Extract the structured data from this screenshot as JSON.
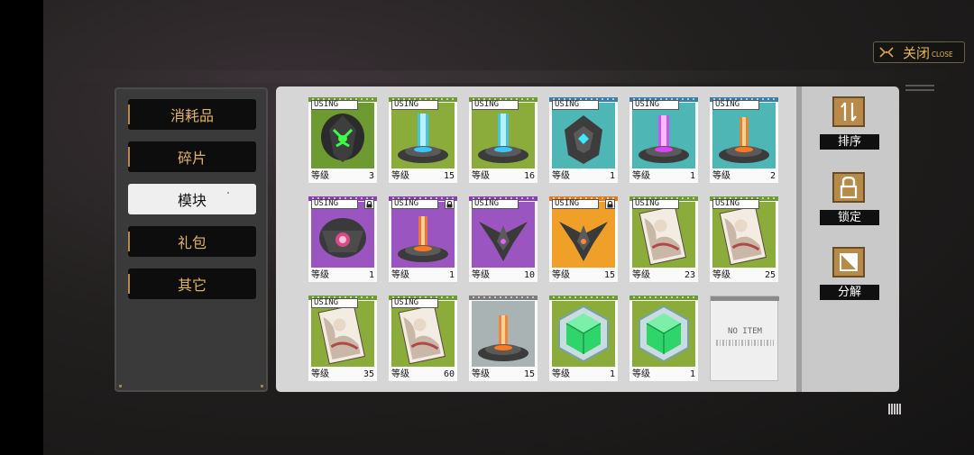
{
  "close": {
    "label": "关闭",
    "sub_label": "CLOSE",
    "icon": "close-x-icon"
  },
  "categories": [
    {
      "label": "消耗品",
      "active": false
    },
    {
      "label": "碎片",
      "active": false
    },
    {
      "label": "模块",
      "active": true
    },
    {
      "label": "礼包",
      "active": false
    },
    {
      "label": "其它",
      "active": false
    }
  ],
  "items": [
    {
      "status": "USING",
      "level_label": "等级",
      "level": "3",
      "frame": "#6e9a32",
      "bg": "#6e9a32",
      "art": "green-core-module",
      "locked": false
    },
    {
      "status": "USING",
      "level_label": "等级",
      "level": "15",
      "frame": "#6e9a32",
      "bg": "#8bab3a",
      "art": "blue-beam-pedestal",
      "locked": false
    },
    {
      "status": "USING",
      "level_label": "等级",
      "level": "16",
      "frame": "#6e9a32",
      "bg": "#8bab3a",
      "art": "blue-beam-pedestal",
      "locked": false
    },
    {
      "status": "USING",
      "level_label": "等级",
      "level": "1",
      "frame": "#3a7fa6",
      "bg": "#4fb6b6",
      "art": "cyan-core-module",
      "locked": false
    },
    {
      "status": "USING",
      "level_label": "等级",
      "level": "1",
      "frame": "#3a7fa6",
      "bg": "#4fb6b6",
      "art": "magenta-beam-pedestal",
      "locked": false
    },
    {
      "status": "USING",
      "level_label": "等级",
      "level": "2",
      "frame": "#3a7fa6",
      "bg": "#4fb6b6",
      "art": "orange-beam-pedestal",
      "locked": false
    },
    {
      "status": "USING",
      "level_label": "等级",
      "level": "1",
      "frame": "#8a3fb0",
      "bg": "#9b55c0",
      "art": "purple-core-module",
      "locked": true
    },
    {
      "status": "USING",
      "level_label": "等级",
      "level": "1",
      "frame": "#8a3fb0",
      "bg": "#9b55c0",
      "art": "orange-beam-pedestal",
      "locked": true
    },
    {
      "status": "USING",
      "level_label": "等级",
      "level": "10",
      "frame": "#8a3fb0",
      "bg": "#9b55c0",
      "art": "purple-star-module",
      "locked": false
    },
    {
      "status": "USING",
      "level_label": "等级",
      "level": "15",
      "frame": "#e07a1c",
      "bg": "#f0a028",
      "art": "orange-star-module",
      "locked": true
    },
    {
      "status": "USING",
      "level_label": "等级",
      "level": "23",
      "frame": "#6e9a32",
      "bg": "#8bab3a",
      "art": "character-card",
      "locked": false
    },
    {
      "status": "USING",
      "level_label": "等级",
      "level": "25",
      "frame": "#6e9a32",
      "bg": "#8bab3a",
      "art": "character-card",
      "locked": false
    },
    {
      "status": "USING",
      "level_label": "等级",
      "level": "35",
      "frame": "#6e9a32",
      "bg": "#8bab3a",
      "art": "character-card",
      "locked": false
    },
    {
      "status": "USING",
      "level_label": "等级",
      "level": "60",
      "frame": "#6e9a32",
      "bg": "#8bab3a",
      "art": "character-card",
      "locked": false
    },
    {
      "status": "",
      "level_label": "等级",
      "level": "15",
      "frame": "#7a7a7a",
      "bg": "#aab3b3",
      "art": "orange-beam-pedestal",
      "locked": false
    },
    {
      "status": "",
      "level_label": "等级",
      "level": "1",
      "frame": "#6e9a32",
      "bg": "#8bab3a",
      "art": "green-crystal",
      "locked": false
    },
    {
      "status": "",
      "level_label": "等级",
      "level": "1",
      "frame": "#6e9a32",
      "bg": "#8bab3a",
      "art": "green-crystal",
      "locked": false
    }
  ],
  "empty_slot": {
    "label": "NO ITEM"
  },
  "actions": [
    {
      "label": "排序",
      "icon": "sort-icon"
    },
    {
      "label": "锁定",
      "icon": "lock-icon"
    },
    {
      "label": "分解",
      "icon": "decompose-icon"
    }
  ]
}
